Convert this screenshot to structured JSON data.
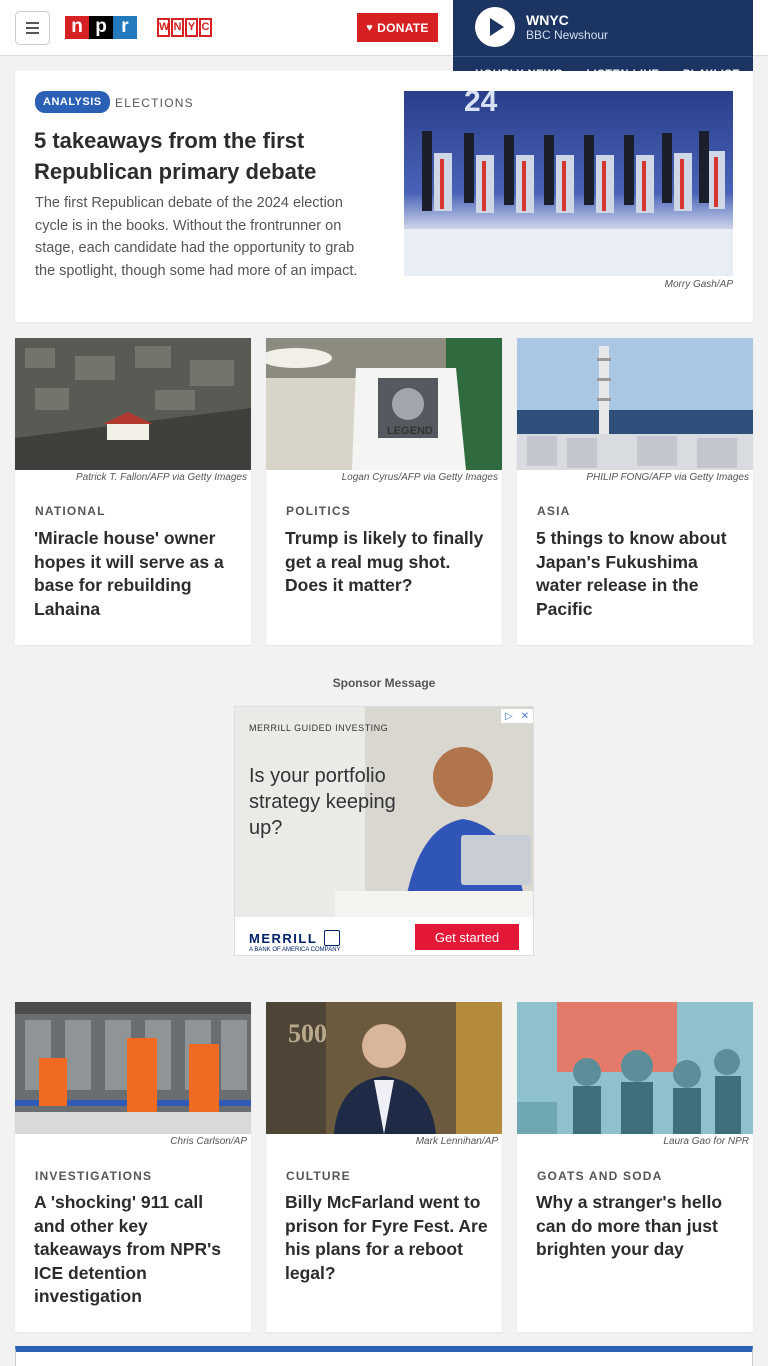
{
  "header": {
    "logo_letters": [
      "n",
      "p",
      "r"
    ],
    "station_logo_letters": [
      "W",
      "N",
      "Y",
      "C"
    ],
    "donate_label": "DONATE",
    "player": {
      "station": "WNYC",
      "program": "BBC Newshour",
      "links": [
        "HOURLY NEWS",
        "LISTEN LIVE",
        "PLAYLIST"
      ]
    }
  },
  "featured": {
    "badge": "ANALYSIS",
    "section": "ELECTIONS",
    "title": "5 takeaways from the first Republican primary debate",
    "teaser": "The first Republican debate of the 2024 election cycle is in the books. Without the frontrunner on stage, each candidate had the opportunity to grab the spotlight, though some had more of an impact.",
    "credit": "Morry Gash/AP",
    "image_text": "24"
  },
  "row1": [
    {
      "credit": "Patrick T. Fallon/AFP via Getty Images",
      "slug": "NATIONAL",
      "title": "'Miracle house' owner hopes it will serve as a base for rebuilding Lahaina"
    },
    {
      "credit": "Logan Cyrus/AFP via Getty Images",
      "slug": "POLITICS",
      "title": "Trump is likely to finally get a real mug shot. Does it matter?",
      "image_text": "LEGEND"
    },
    {
      "credit": "PHILIP FONG/AFP via Getty Images",
      "slug": "ASIA",
      "title": "5 things to know about Japan's Fukushima water release in the Pacific"
    }
  ],
  "sponsor": {
    "label": "Sponsor Message",
    "ad_kicker": "MERRILL GUIDED INVESTING",
    "ad_headline": "Is your portfolio strategy keeping up?",
    "ad_brand": "MERRILL",
    "ad_sub": "A BANK OF AMERICA COMPANY",
    "ad_cta": "Get started"
  },
  "row2": [
    {
      "credit": "Chris Carlson/AP",
      "slug": "INVESTIGATIONS",
      "title": "A 'shocking' 911 call and other key takeaways from NPR's ICE detention investigation"
    },
    {
      "credit": "Mark Lennihan/AP",
      "slug": "CULTURE",
      "title": "Billy McFarland went to prison for Fyre Fest. Are his plans for a reboot legal?",
      "image_text": "500"
    },
    {
      "credit": "Laura Gao for NPR",
      "slug": "GOATS AND SODA",
      "title": "Why a stranger's hello can do more than just brighten your day"
    }
  ],
  "colors": {
    "npr_red": "#d62021",
    "npr_blue": "#237bbd",
    "player_navy": "#1c3461",
    "badge_blue": "#2a60b5"
  }
}
